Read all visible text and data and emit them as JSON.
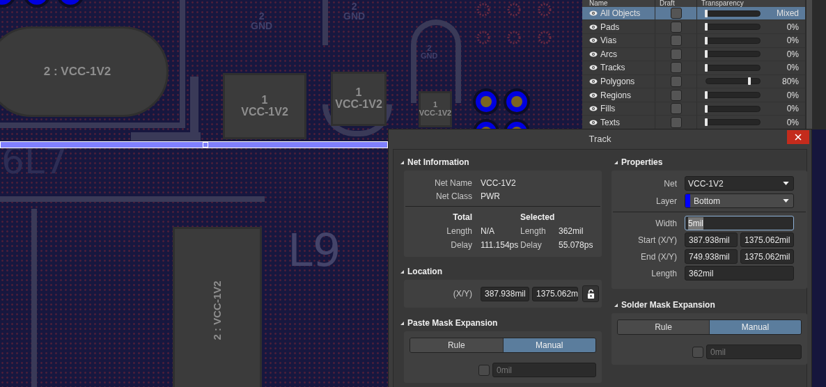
{
  "canvas": {
    "pads": [
      {
        "kind": "oval",
        "lines": [
          "2 : VCC-1V2"
        ]
      },
      {
        "kind": "square",
        "lines": [
          "1",
          "VCC-1V2"
        ]
      },
      {
        "kind": "square",
        "lines": [
          "1",
          "VCC-1V2"
        ]
      },
      {
        "kind": "small",
        "lines": [
          "1",
          "VCC-1V2"
        ]
      },
      {
        "kind": "vertical",
        "lines": [
          "2 : VCC-1V2"
        ]
      }
    ],
    "net_labels": [
      {
        "number": "2",
        "net": "GND"
      },
      {
        "number": "2",
        "net": "GND"
      },
      {
        "number": "2",
        "net": "GND"
      }
    ],
    "silkscreen": [
      "6L7",
      "L9"
    ]
  },
  "layer_panel": {
    "columns": [
      "Name",
      "Draft",
      "Transparency"
    ],
    "rows": [
      {
        "name": "All Objects",
        "selected": true,
        "draft": false,
        "level": 0,
        "reading": "Mixed"
      },
      {
        "name": "Pads",
        "selected": false,
        "draft": false,
        "level": 0,
        "reading": "0%"
      },
      {
        "name": "Vias",
        "selected": false,
        "draft": false,
        "level": 0,
        "reading": "0%"
      },
      {
        "name": "Arcs",
        "selected": false,
        "draft": false,
        "level": 0,
        "reading": "0%"
      },
      {
        "name": "Tracks",
        "selected": false,
        "draft": false,
        "level": 0,
        "reading": "0%"
      },
      {
        "name": "Polygons",
        "selected": false,
        "draft": false,
        "level": 0.8,
        "reading": "80%"
      },
      {
        "name": "Regions",
        "selected": false,
        "draft": false,
        "level": 0,
        "reading": "0%"
      },
      {
        "name": "Fills",
        "selected": false,
        "draft": false,
        "level": 0,
        "reading": "0%"
      },
      {
        "name": "Texts",
        "selected": false,
        "draft": false,
        "level": 0,
        "reading": "0%"
      }
    ]
  },
  "dialog": {
    "title": "Track",
    "net_information": {
      "title": "Net Information",
      "net_name_label": "Net Name",
      "net_name": "VCC-1V2",
      "net_class_label": "Net Class",
      "net_class": "PWR",
      "total_heading": "Total",
      "selected_heading": "Selected",
      "rows": [
        {
          "label": "Length",
          "total": "N/A",
          "selected_label": "Length",
          "selected": "362mil"
        },
        {
          "label": "Delay",
          "total": "111.154ps",
          "selected_label": "Delay",
          "selected": "55.078ps"
        }
      ]
    },
    "location": {
      "title": "Location",
      "label": "(X/Y)",
      "x": "387.938mil",
      "y": "1375.062m",
      "locked": false
    },
    "paste_mask_expansion": {
      "title": "Paste Mask Expansion",
      "options": [
        {
          "label": "Rule",
          "selected": false
        },
        {
          "label": "Manual",
          "selected": true
        }
      ],
      "checked": false,
      "value": "0mil",
      "disabled": true
    },
    "properties": {
      "title": "Properties",
      "net": {
        "label": "Net",
        "value": "VCC-1V2"
      },
      "layer": {
        "label": "Layer",
        "value": "Bottom",
        "color": "#0000ff"
      },
      "width": {
        "label": "Width",
        "value": "5mil",
        "focused": true
      },
      "start": {
        "label": "Start (X/Y)",
        "x": "387.938mil",
        "y": "1375.062mil"
      },
      "end": {
        "label": "End (X/Y)",
        "x": "749.938mil",
        "y": "1375.062mil"
      },
      "length": {
        "label": "Length",
        "value": "362mil"
      }
    },
    "solder_mask_expansion": {
      "title": "Solder Mask Expansion",
      "options": [
        {
          "label": "Rule",
          "selected": false
        },
        {
          "label": "Manual",
          "selected": true
        }
      ],
      "checked": false,
      "value": "0mil",
      "disabled": true
    }
  }
}
